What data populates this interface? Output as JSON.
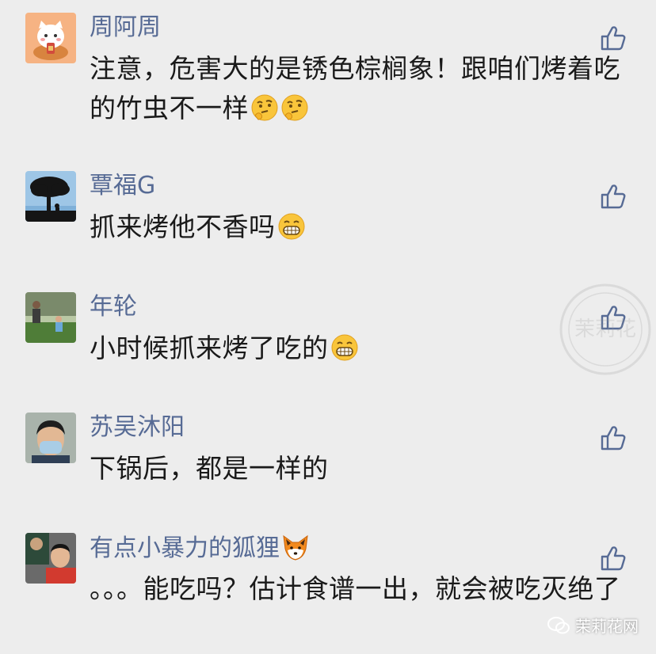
{
  "comments": [
    {
      "author": "周阿周",
      "text": "注意，危害大的是锈色棕榈象！跟咱们烤着吃的竹虫不一样",
      "emoji": [
        "thinking-face",
        "thinking-face"
      ]
    },
    {
      "author": "覃福G",
      "text": "抓来烤他不香吗",
      "emoji": [
        "grinning-face"
      ]
    },
    {
      "author": "年轮",
      "text": "小时候抓来烤了吃的",
      "emoji": [
        "grinning-face"
      ]
    },
    {
      "author": "苏吴沐阳",
      "text": "下锅后，都是一样的",
      "emoji": []
    },
    {
      "author": "有点小暴力的狐狸",
      "author_emoji": "fox-face",
      "text": "。。。能吃吗？估计食谱一出，就会被吃灭绝了",
      "emoji": []
    }
  ],
  "watermark": {
    "seal_text": "茉莉花",
    "footer_text": "茉莉花网"
  },
  "colors": {
    "background": "#ededed",
    "author_name": "#576b95",
    "comment_text": "#1a1a1a",
    "like_icon": "#576b95"
  },
  "icons": {
    "like": "thumbs-up-outline-icon"
  }
}
